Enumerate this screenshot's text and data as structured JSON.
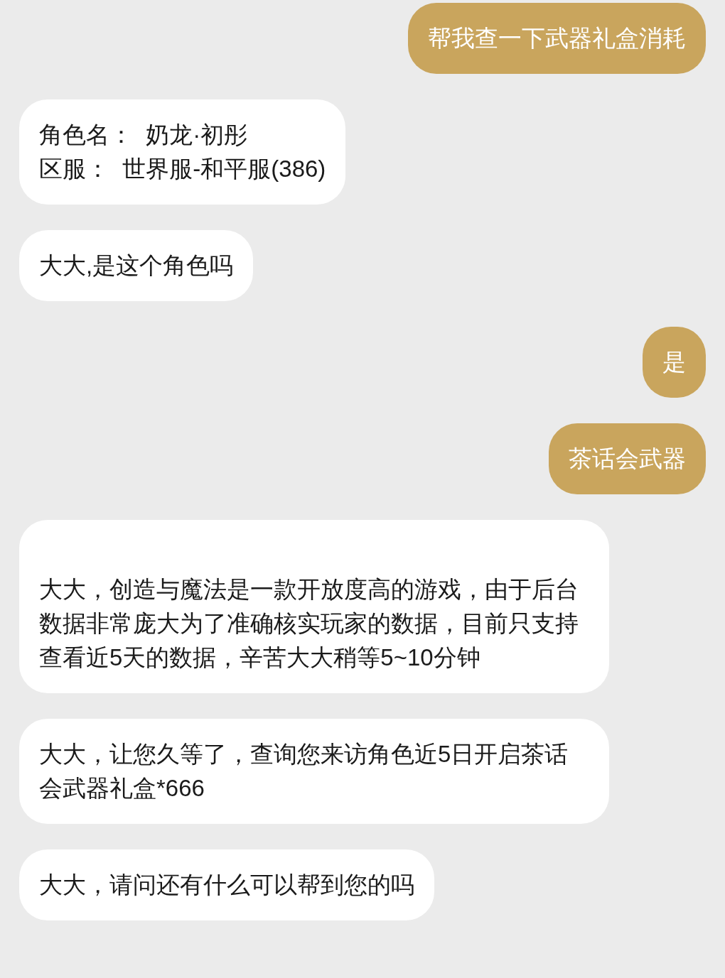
{
  "messages": [
    {
      "kind": "outgoing",
      "lines": [
        "帮我查一下武器礼盒消耗"
      ]
    },
    {
      "kind": "incoming",
      "lines": [
        "角色名：  奶龙·初彤",
        "区服：  世界服-和平服(386)"
      ]
    },
    {
      "kind": "incoming",
      "lines": [
        "大大,是这个角色吗"
      ]
    },
    {
      "kind": "outgoing",
      "lines": [
        "是"
      ]
    },
    {
      "kind": "outgoing",
      "lines": [
        "茶话会武器"
      ]
    },
    {
      "kind": "incoming",
      "lines": [
        "\n大大，创造与魔法是一款开放度高的游戏，由于后台数据非常庞大为了准确核实玩家的数据，目前只支持查看近5天的数据，辛苦大大稍等5~10分钟"
      ]
    },
    {
      "kind": "incoming",
      "lines": [
        "大大，让您久等了，查询您来访角色近5日开启茶话会武器礼盒*666"
      ]
    },
    {
      "kind": "incoming",
      "lines": [
        "大大，请问还有什么可以帮到您的吗"
      ]
    }
  ]
}
